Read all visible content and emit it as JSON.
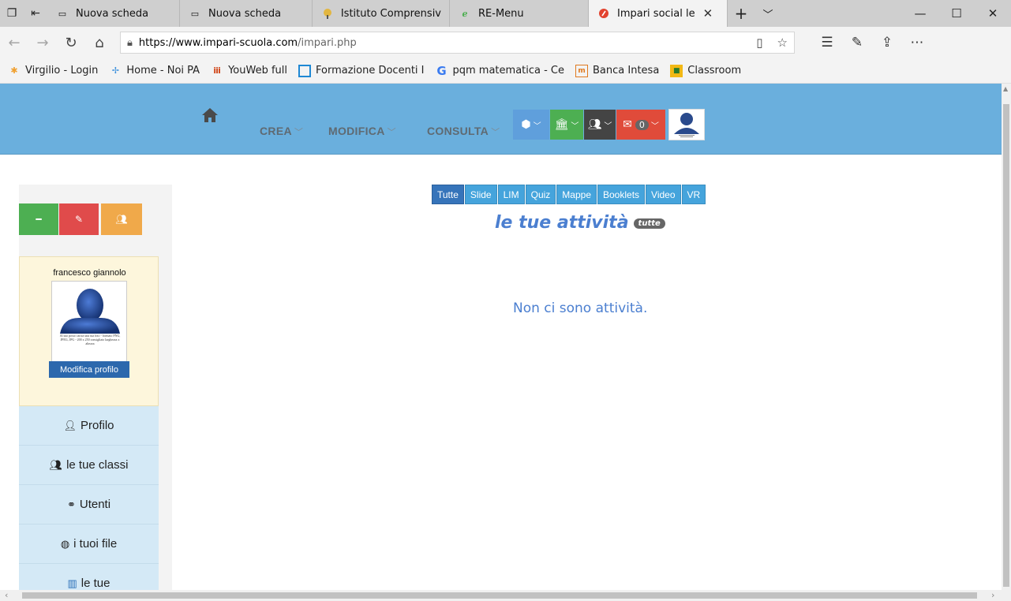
{
  "browser": {
    "tabs": [
      {
        "title": "Nuova scheda",
        "icon": "page-icon",
        "active": false
      },
      {
        "title": "Nuova scheda",
        "icon": "page-icon",
        "active": false
      },
      {
        "title": "Istituto Comprensiv",
        "icon": "school-icon",
        "active": false
      },
      {
        "title": "RE-Menu",
        "icon": "edge-icon",
        "active": false
      },
      {
        "title": "Impari social le",
        "icon": "impari-icon",
        "active": true
      }
    ],
    "url": {
      "domain": "https://www.impari-scuola.com",
      "path": "/impari.php"
    },
    "favorites": [
      {
        "label": "Virgilio - Login",
        "icon": "virgilio-icon"
      },
      {
        "label": "Home - Noi PA",
        "icon": "noipa-icon"
      },
      {
        "label": "YouWeb full",
        "icon": "youweb-icon"
      },
      {
        "label": "Formazione Docenti I",
        "icon": "formazione-icon"
      },
      {
        "label": "pqm matematica - Ce",
        "icon": "google-icon"
      },
      {
        "label": "Banca Intesa",
        "icon": "banca-icon"
      },
      {
        "label": "Classroom",
        "icon": "classroom-icon"
      }
    ]
  },
  "nav": {
    "menu": [
      {
        "label": "CREA"
      },
      {
        "label": "MODIFICA"
      },
      {
        "label": "CONSULTA"
      }
    ],
    "mail_count": "0"
  },
  "sidebar": {
    "user_name": "francesco giannolo",
    "photo_caption": "Al suo posto carica una tua foto - formato PNG, JPEG, JPG - 200 x 250 consigliato larghezza x altezza",
    "edit_profile_label": "Modifica profilo",
    "menu": [
      {
        "label": "Profilo",
        "icon": "user-icon"
      },
      {
        "label": "le tue classi",
        "icon": "users-icon"
      },
      {
        "label": "Utenti",
        "icon": "binoculars-icon"
      },
      {
        "label": "i tuoi file",
        "icon": "globe-icon"
      },
      {
        "label": "le tue",
        "icon": "chart-icon"
      }
    ]
  },
  "main": {
    "filters": [
      "Tutte",
      "Slide",
      "LIM",
      "Quiz",
      "Mappe",
      "Booklets",
      "Video",
      "VR"
    ],
    "active_filter": "Tutte",
    "heading": "le tue attività",
    "heading_badge": "tutte",
    "empty_message": "Non ci sono attività."
  },
  "colors": {
    "nav_bg": "#6aafdd",
    "filter_bg": "#45a4dc",
    "filter_active": "#3674ba",
    "heading": "#4b7fd0",
    "green": "#4daf52",
    "red": "#e04b4b",
    "orange": "#f0a94a"
  }
}
